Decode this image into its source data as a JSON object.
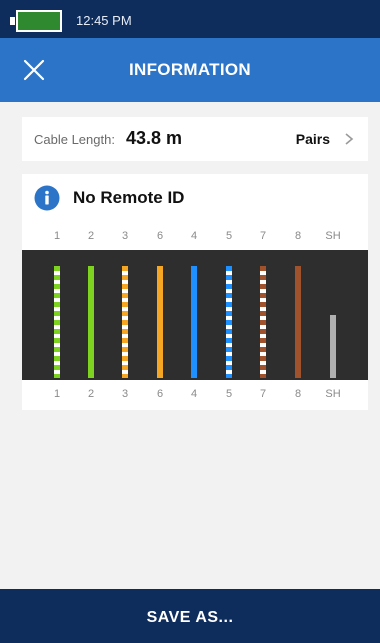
{
  "status_bar": {
    "time": "12:45 PM",
    "battery_color": "#2f8a2f"
  },
  "app_bar": {
    "title": "INFORMATION",
    "close_icon": "close-icon"
  },
  "cable": {
    "length_label": "Cable Length:",
    "length_value": "43.8 m",
    "pairs_label": "Pairs",
    "pairs_icon": "chevron-right-icon"
  },
  "remote": {
    "title": "No Remote ID",
    "icon": "info-icon"
  },
  "wires": [
    {
      "pin": "1",
      "color": "#7ed321",
      "style": "striped",
      "level": 1.0
    },
    {
      "pin": "2",
      "color": "#7ed321",
      "style": "solid",
      "level": 1.0
    },
    {
      "pin": "3",
      "color": "#f5a623",
      "style": "striped",
      "level": 1.0
    },
    {
      "pin": "6",
      "color": "#f5a623",
      "style": "solid",
      "level": 1.0
    },
    {
      "pin": "4",
      "color": "#1e90ff",
      "style": "solid",
      "level": 1.0
    },
    {
      "pin": "5",
      "color": "#1e90ff",
      "style": "striped",
      "level": 1.0
    },
    {
      "pin": "7",
      "color": "#a0522d",
      "style": "striped",
      "level": 1.0
    },
    {
      "pin": "8",
      "color": "#a0522d",
      "style": "solid",
      "level": 1.0
    },
    {
      "pin": "SH",
      "color": "#b0b0b0",
      "style": "solid",
      "level": 0.56
    }
  ],
  "footer": {
    "save_label": "SAVE AS..."
  },
  "colors": {
    "header_dark": "#0f2d5c",
    "header_blue": "#2b74c7",
    "panel": "#2e2e2e"
  }
}
